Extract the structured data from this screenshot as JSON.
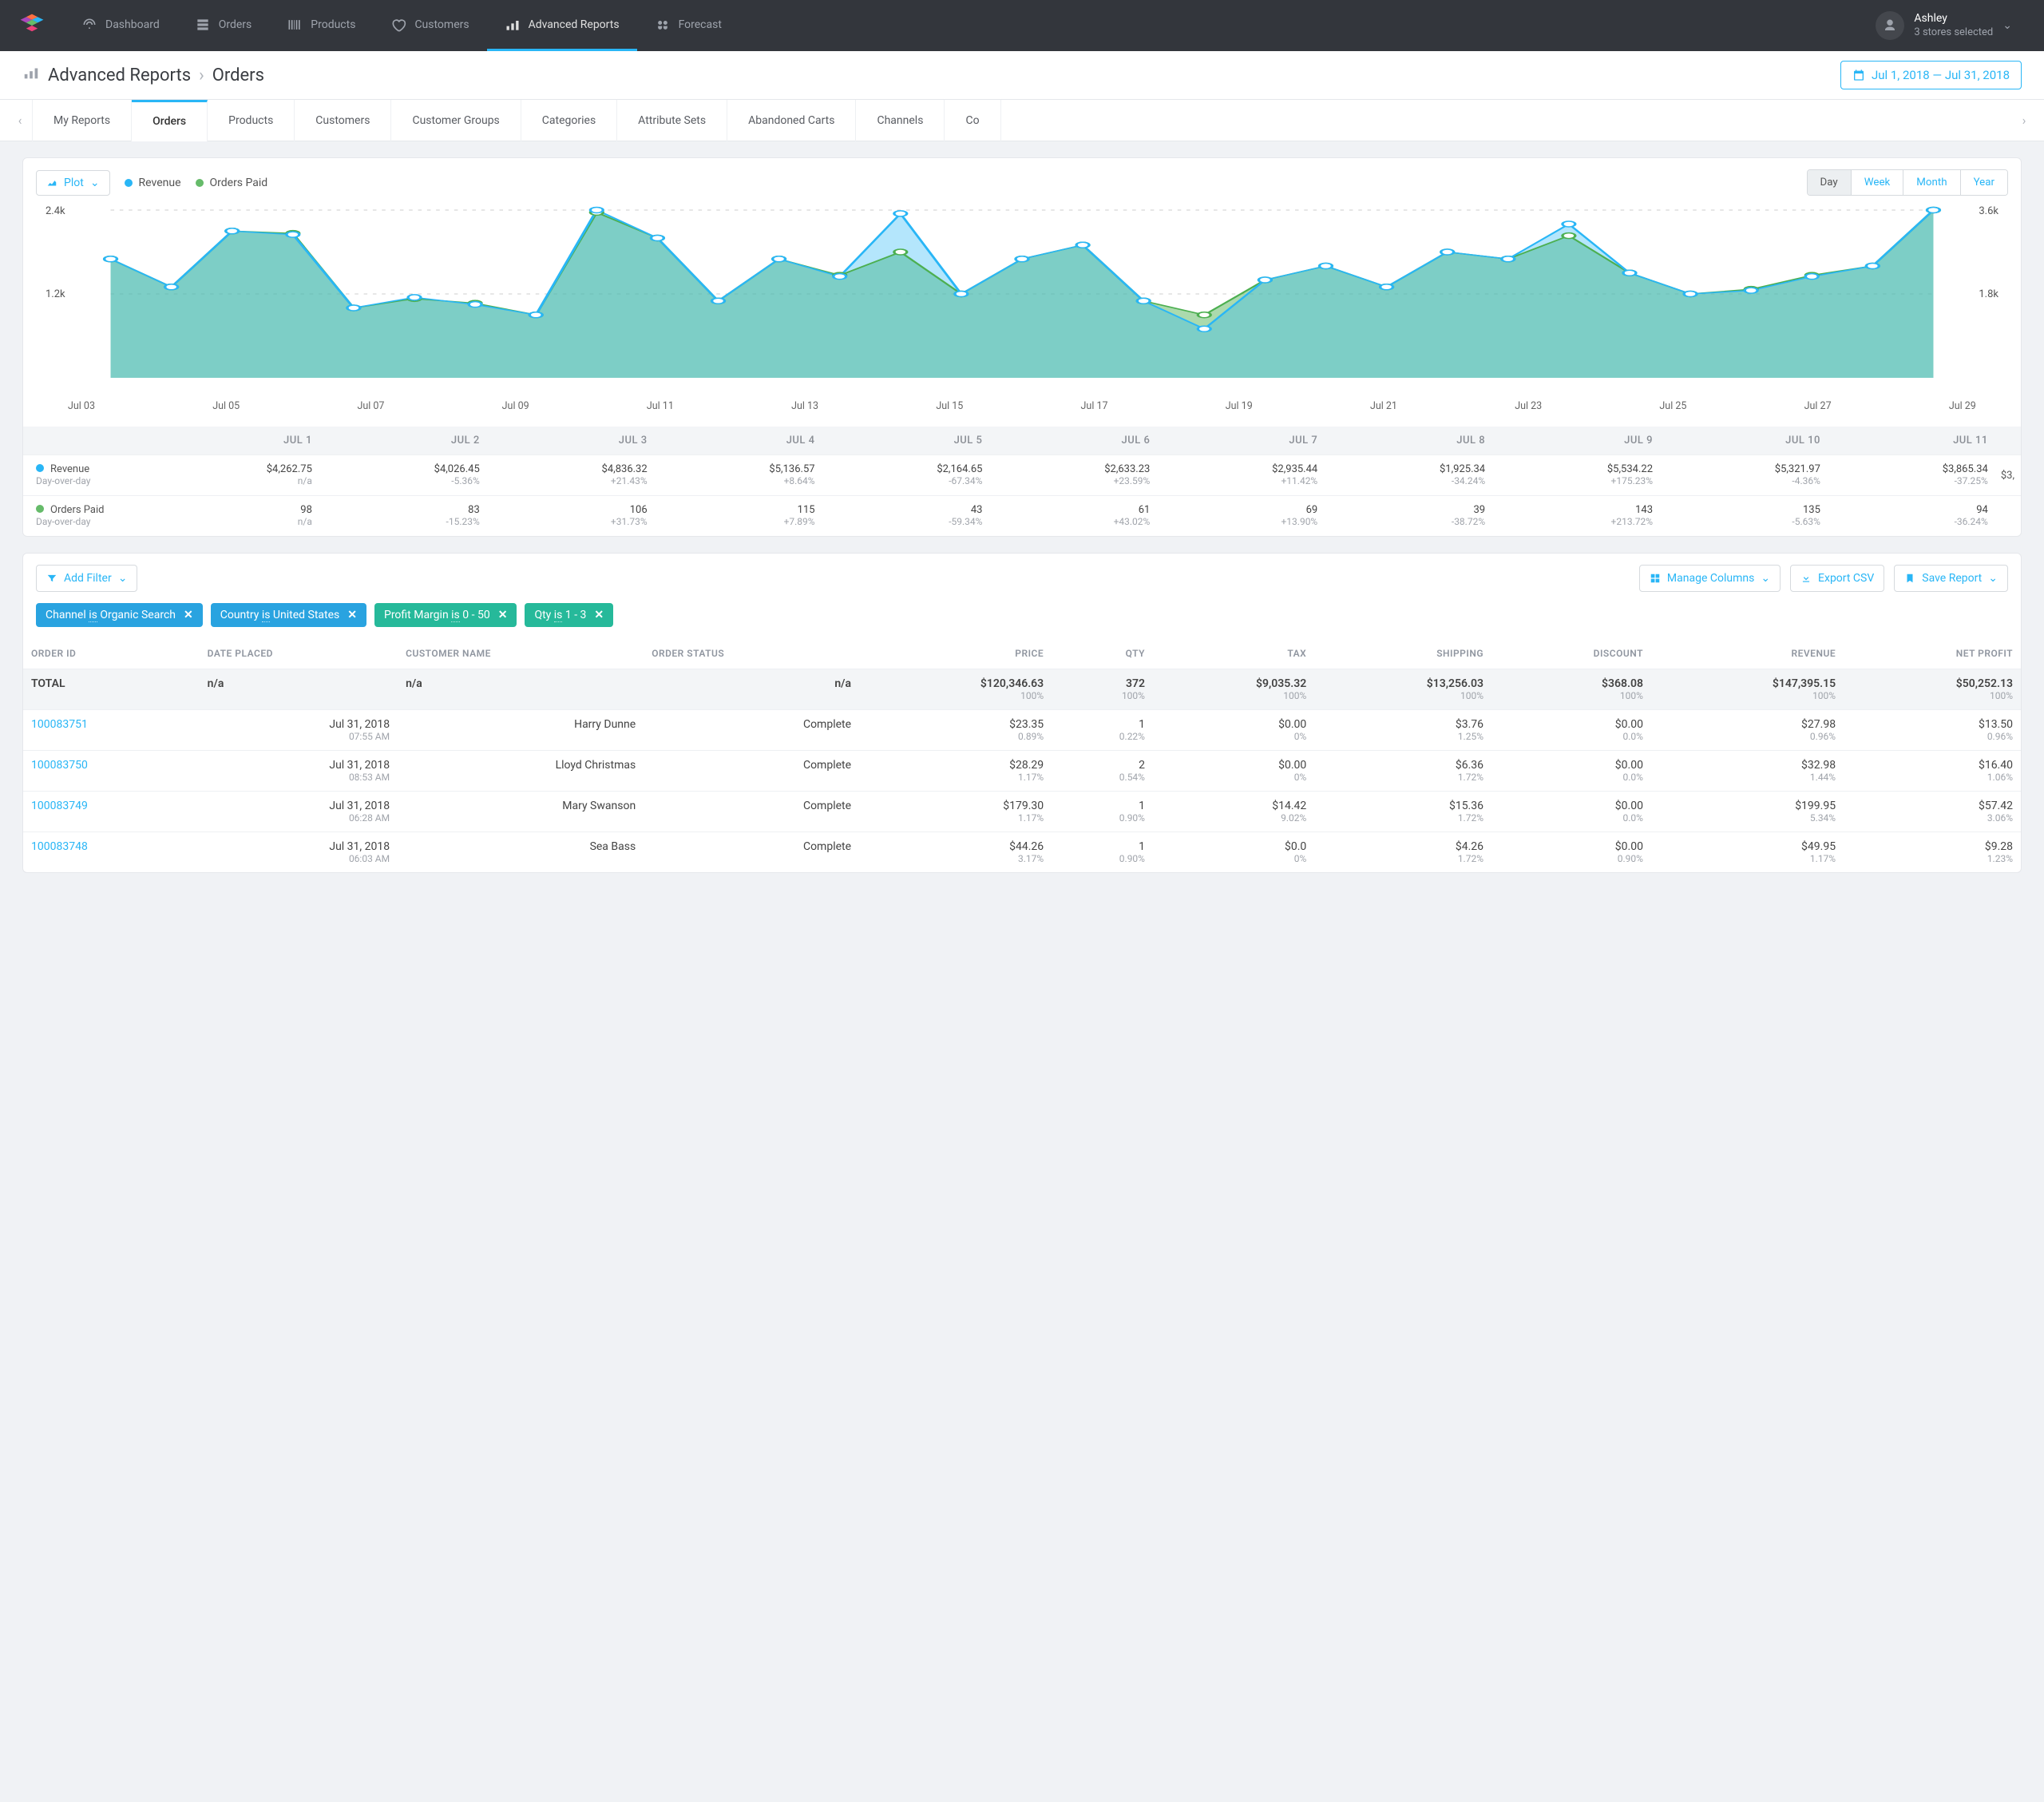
{
  "nav": {
    "items": [
      "Dashboard",
      "Orders",
      "Products",
      "Customers",
      "Advanced Reports",
      "Forecast"
    ],
    "active": 4
  },
  "user": {
    "name": "Ashley",
    "sub": "3 stores selected"
  },
  "breadcrumb": {
    "section": "Advanced Reports",
    "page": "Orders"
  },
  "date_range": "Jul 1, 2018 — Jul 31, 2018",
  "tabs": {
    "items": [
      "My Reports",
      "Orders",
      "Products",
      "Customers",
      "Customer Groups",
      "Categories",
      "Attribute Sets",
      "Abandoned Carts",
      "Channels",
      "Co"
    ],
    "active": 1
  },
  "plot_label": "Plot",
  "legend": {
    "a": "Revenue",
    "b": "Orders Paid"
  },
  "period": {
    "options": [
      "Day",
      "Week",
      "Month",
      "Year"
    ],
    "active": 0
  },
  "chart_data": {
    "type": "area",
    "x_ticks": [
      "Jul 03",
      "Jul 05",
      "Jul 07",
      "Jul 09",
      "Jul 11",
      "Jul 13",
      "Jul 15",
      "Jul 17",
      "Jul 19",
      "Jul 21",
      "Jul 23",
      "Jul 25",
      "Jul 27",
      "Jul 29"
    ],
    "y_left_ticks": [
      "2.4k",
      "1.2k"
    ],
    "y_right_ticks": [
      "3.6k",
      "1.8k"
    ],
    "series": [
      {
        "name": "Revenue",
        "color": "#29b6f6",
        "values": [
          1700,
          1300,
          2100,
          2050,
          1000,
          1150,
          1050,
          900,
          2400,
          2000,
          1100,
          1700,
          1450,
          2350,
          1200,
          1700,
          1900,
          1100,
          700,
          1400,
          1600,
          1300,
          1800,
          1700,
          2200,
          1500,
          1200,
          1250,
          1450,
          1600,
          2400
        ]
      },
      {
        "name": "Orders Paid",
        "color": "#66bb6a",
        "values": [
          2550,
          1950,
          3150,
          3100,
          1500,
          1700,
          1600,
          1350,
          3550,
          3000,
          1650,
          2550,
          2200,
          2700,
          1800,
          2550,
          2850,
          1650,
          1350,
          2100,
          2400,
          1950,
          2700,
          2550,
          3050,
          2250,
          1800,
          1900,
          2200,
          2400,
          3600
        ]
      }
    ]
  },
  "mini_tbl": {
    "headers": [
      "JUL 1",
      "JUL 2",
      "JUL 3",
      "JUL 4",
      "JUL 5",
      "JUL 6",
      "JUL 7",
      "JUL 8",
      "JUL 9",
      "JUL 10",
      "JUL 11"
    ],
    "rows": [
      {
        "label": "Revenue",
        "sub": "Day-over-day",
        "dot": "blue",
        "cells": [
          {
            "v": "$4,262.75",
            "p": "n/a"
          },
          {
            "v": "$4,026.45",
            "p": "-5.36%"
          },
          {
            "v": "$4,836.32",
            "p": "+21.43%"
          },
          {
            "v": "$5,136.57",
            "p": "+8.64%"
          },
          {
            "v": "$2,164.65",
            "p": "-67.34%"
          },
          {
            "v": "$2,633.23",
            "p": "+23.59%"
          },
          {
            "v": "$2,935.44",
            "p": "+11.42%"
          },
          {
            "v": "$1,925.34",
            "p": "-34.24%"
          },
          {
            "v": "$5,534.22",
            "p": "+175.23%"
          },
          {
            "v": "$5,321.97",
            "p": "-4.36%"
          },
          {
            "v": "$3,865.34",
            "p": "-37.25%"
          }
        ],
        "trunc": "$3,"
      },
      {
        "label": "Orders Paid",
        "sub": "Day-over-day",
        "dot": "green",
        "cells": [
          {
            "v": "98",
            "p": "n/a"
          },
          {
            "v": "83",
            "p": "-15.23%"
          },
          {
            "v": "106",
            "p": "+31.73%"
          },
          {
            "v": "115",
            "p": "+7.89%"
          },
          {
            "v": "43",
            "p": "-59.34%"
          },
          {
            "v": "61",
            "p": "+43.02%"
          },
          {
            "v": "69",
            "p": "+13.90%"
          },
          {
            "v": "39",
            "p": "-38.72%"
          },
          {
            "v": "143",
            "p": "+213.72%"
          },
          {
            "v": "135",
            "p": "-5.63%"
          },
          {
            "v": "94",
            "p": "-36.24%"
          }
        ],
        "trunc": ""
      }
    ]
  },
  "actions": {
    "add_filter": "Add Filter",
    "manage_cols": "Manage Columns",
    "export": "Export CSV",
    "save": "Save Report"
  },
  "chips": [
    {
      "cls": "blue",
      "pre": "Channel ",
      "mid": "is",
      "val": " Organic Search"
    },
    {
      "cls": "blue",
      "pre": "Country ",
      "mid": "is",
      "val": " United States"
    },
    {
      "cls": "green",
      "pre": "Profit Margin ",
      "mid": "is",
      "val": " 0 - 50"
    },
    {
      "cls": "green",
      "pre": "Qty ",
      "mid": "is",
      "val": " 1 - 3"
    }
  ],
  "cols": [
    "ORDER ID",
    "DATE PLACED",
    "CUSTOMER NAME",
    "ORDER STATUS",
    "PRICE",
    "QTY",
    "TAX",
    "SHIPPING",
    "DISCOUNT",
    "REVENUE",
    "NET PROFIT"
  ],
  "total": {
    "label": "TOTAL",
    "date": "n/a",
    "name": "n/a",
    "status": "n/a",
    "price": "$120,346.63",
    "price_p": "100%",
    "qty": "372",
    "qty_p": "100%",
    "tax": "$9,035.32",
    "tax_p": "100%",
    "ship": "$13,256.03",
    "ship_p": "100%",
    "disc": "$368.08",
    "disc_p": "100%",
    "rev": "$147,395.15",
    "rev_p": "100%",
    "np": "$50,252.13",
    "np_p": "100%"
  },
  "rows": [
    {
      "id": "100083751",
      "date": "Jul 31, 2018",
      "time": "07:55 AM",
      "name": "Harry Dunne",
      "status": "Complete",
      "price": "$23.35",
      "price_p": "0.89%",
      "qty": "1",
      "qty_p": "0.22%",
      "tax": "$0.00",
      "tax_p": "0%",
      "ship": "$3.76",
      "ship_p": "1.25%",
      "disc": "$0.00",
      "disc_p": "0.0%",
      "rev": "$27.98",
      "rev_p": "0.96%",
      "np": "$13.50",
      "np_p": "0.96%"
    },
    {
      "id": "100083750",
      "date": "Jul 31, 2018",
      "time": "08:53 AM",
      "name": "Lloyd Christmas",
      "status": "Complete",
      "price": "$28.29",
      "price_p": "1.17%",
      "qty": "2",
      "qty_p": "0.54%",
      "tax": "$0.00",
      "tax_p": "0%",
      "ship": "$6.36",
      "ship_p": "1.72%",
      "disc": "$0.00",
      "disc_p": "0.0%",
      "rev": "$32.98",
      "rev_p": "1.44%",
      "np": "$16.40",
      "np_p": "1.06%"
    },
    {
      "id": "100083749",
      "date": "Jul 31, 2018",
      "time": "06:28 AM",
      "name": "Mary Swanson",
      "status": "Complete",
      "price": "$179.30",
      "price_p": "1.17%",
      "qty": "1",
      "qty_p": "0.90%",
      "tax": "$14.42",
      "tax_p": "9.02%",
      "ship": "$15.36",
      "ship_p": "1.72%",
      "disc": "$0.00",
      "disc_p": "0.0%",
      "rev": "$199.95",
      "rev_p": "5.34%",
      "np": "$57.42",
      "np_p": "3.06%"
    },
    {
      "id": "100083748",
      "date": "Jul 31, 2018",
      "time": "06:03 AM",
      "name": "Sea Bass",
      "status": "Complete",
      "price": "$44.26",
      "price_p": "3.17%",
      "qty": "1",
      "qty_p": "0.90%",
      "tax": "$0.0",
      "tax_p": "0%",
      "ship": "$4.26",
      "ship_p": "1.72%",
      "disc": "$0.00",
      "disc_p": "0.90%",
      "rev": "$49.95",
      "rev_p": "1.17%",
      "np": "$9.28",
      "np_p": "1.23%"
    }
  ]
}
